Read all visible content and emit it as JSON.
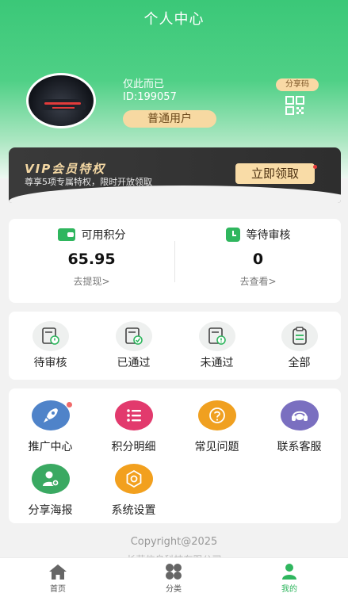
{
  "header": {
    "title": "个人中心"
  },
  "profile": {
    "username": "仅此而已",
    "user_id": "ID:199057",
    "level": "普通用户",
    "share_code_label": "分享码"
  },
  "vip": {
    "title": "VIP会员特权",
    "subtitle": "尊享5项专属特权，限时开放领取",
    "button": "立即领取"
  },
  "points": {
    "available": {
      "label": "可用积分",
      "value": "65.95",
      "link": "去提现>"
    },
    "pending": {
      "label": "等待审核",
      "value": "0",
      "link": "去查看>"
    }
  },
  "status_tabs": [
    {
      "label": "待审核",
      "icon": "pending-doc-icon"
    },
    {
      "label": "已通过",
      "icon": "approved-doc-icon"
    },
    {
      "label": "未通过",
      "icon": "rejected-doc-icon"
    },
    {
      "label": "全部",
      "icon": "all-clipboard-icon"
    }
  ],
  "menu": [
    {
      "label": "推广中心",
      "icon": "rocket-icon",
      "color": "#4f83c9"
    },
    {
      "label": "积分明细",
      "icon": "list-icon",
      "color": "#e23a6d"
    },
    {
      "label": "常见问题",
      "icon": "question-icon",
      "color": "#f0a020"
    },
    {
      "label": "联系客服",
      "icon": "headset-icon",
      "color": "#7a6fc0"
    },
    {
      "label": "分享海报",
      "icon": "share-user-icon",
      "color": "#3aa962"
    },
    {
      "label": "系统设置",
      "icon": "settings-icon",
      "color": "#f2a01e"
    }
  ],
  "footer": {
    "copyright": "Copyright@2025",
    "company": "长荣信息科技有限公司"
  },
  "tabbar": [
    {
      "label": "首页",
      "icon": "home-icon"
    },
    {
      "label": "分类",
      "icon": "category-icon"
    },
    {
      "label": "我的",
      "icon": "user-icon"
    }
  ],
  "colors": {
    "primary": "#2fb65e",
    "accent_gold": "#f9dca7"
  }
}
